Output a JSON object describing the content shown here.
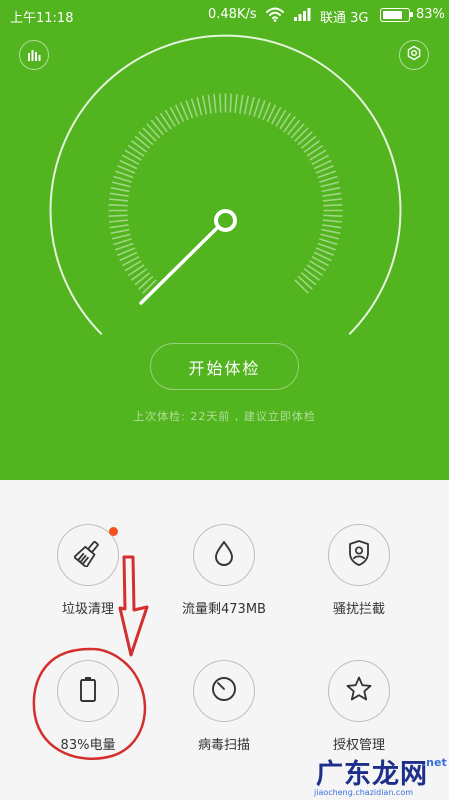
{
  "status_bar": {
    "time": "上午11:18",
    "speed": "0.48K/s",
    "carrier": "联通 3G",
    "battery_text": "83%",
    "battery_level": 0.83
  },
  "header": {
    "left_icon": "chart-icon",
    "right_icon": "gear-icon"
  },
  "gauge": {
    "needle_level": 0.0
  },
  "main": {
    "start_button": "开始体检",
    "last_check": "上次体检: 22天前 , 建议立即体检"
  },
  "tools": [
    {
      "label": "垃圾清理",
      "icon": "broom-icon",
      "badge": true
    },
    {
      "label": "流量剩473MB",
      "icon": "drop-icon",
      "badge": false
    },
    {
      "label": "骚扰拦截",
      "icon": "shield-user-icon",
      "badge": false
    },
    {
      "label": "83%电量",
      "icon": "battery-icon",
      "badge": false
    },
    {
      "label": "病毒扫描",
      "icon": "virus-scan-icon",
      "badge": false
    },
    {
      "label": "授权管理",
      "icon": "star-icon",
      "badge": false
    }
  ],
  "watermark": {
    "brand": "广东龙网",
    "tld": ".net",
    "url": "jiaocheng.chazidian.com"
  },
  "colors": {
    "accent": "#52b41e",
    "annotation": "#d32f2f",
    "badge": "#f4511e"
  }
}
